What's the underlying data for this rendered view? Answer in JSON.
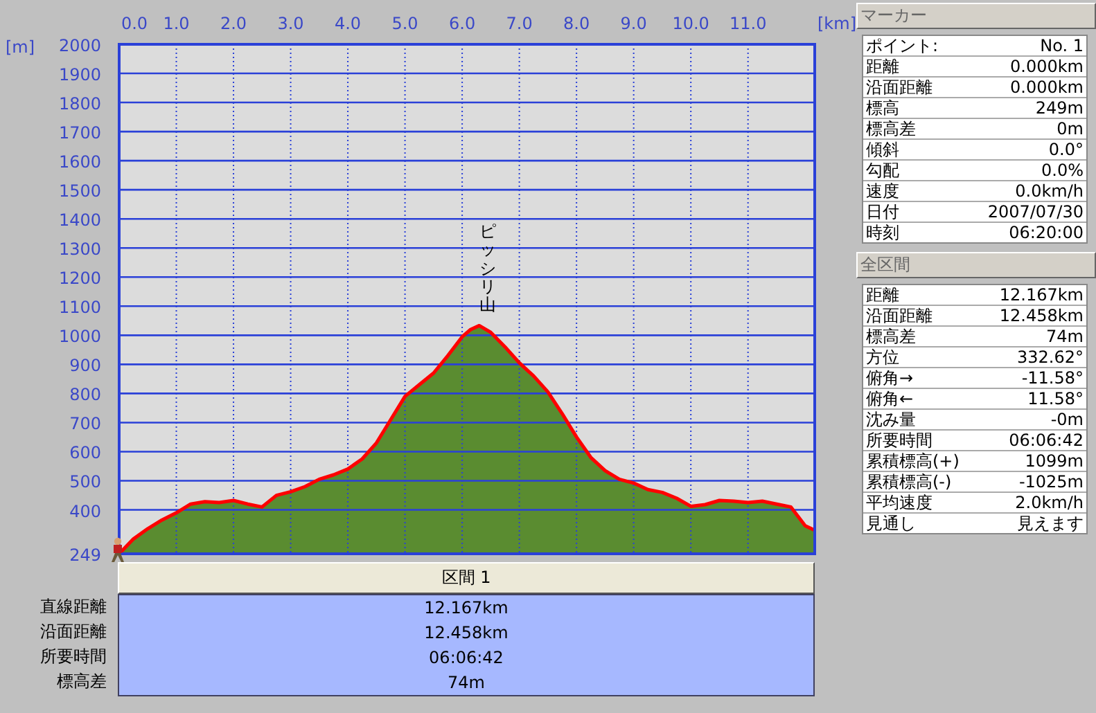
{
  "chart": {
    "chart_data": {
      "type": "area",
      "xlabel": "[km]",
      "ylabel": "[m]",
      "x": [
        0,
        0.25,
        0.5,
        0.75,
        1.0,
        1.25,
        1.5,
        1.75,
        2.0,
        2.25,
        2.5,
        2.75,
        3.0,
        3.25,
        3.5,
        3.75,
        4.0,
        4.25,
        4.5,
        4.75,
        5.0,
        5.25,
        5.5,
        5.75,
        6.0,
        6.15,
        6.3,
        6.5,
        6.75,
        7.0,
        7.25,
        7.5,
        7.75,
        8.0,
        8.25,
        8.5,
        8.75,
        9.0,
        9.25,
        9.5,
        9.75,
        10.0,
        10.25,
        10.5,
        10.75,
        11.0,
        11.25,
        11.5,
        11.75,
        12.0,
        12.167
      ],
      "grid": true,
      "series": [
        {
          "color": "#5a8c30",
          "values": [
            249,
            300,
            335,
            365,
            390,
            420,
            428,
            425,
            432,
            420,
            410,
            450,
            462,
            480,
            505,
            520,
            540,
            575,
            630,
            710,
            790,
            830,
            870,
            930,
            995,
            1020,
            1033,
            1010,
            960,
            905,
            860,
            805,
            730,
            650,
            580,
            535,
            505,
            492,
            470,
            460,
            440,
            412,
            418,
            432,
            430,
            425,
            430,
            420,
            410,
            345,
            330
          ]
        }
      ],
      "xlim": [
        0,
        12.167
      ],
      "ylim": [
        249,
        2000
      ],
      "xticks": [
        {
          "value": 0,
          "label": "0.0"
        },
        {
          "value": 1,
          "label": "1.0"
        },
        {
          "value": 2,
          "label": "2.0"
        },
        {
          "value": 3,
          "label": "3.0"
        },
        {
          "value": 4,
          "label": "4.0"
        },
        {
          "value": 5,
          "label": "5.0"
        },
        {
          "value": 6,
          "label": "6.0"
        },
        {
          "value": 7,
          "label": "7.0"
        },
        {
          "value": 8,
          "label": "8.0"
        },
        {
          "value": 9,
          "label": "9.0"
        },
        {
          "value": 10,
          "label": "10.0"
        },
        {
          "value": 11,
          "label": "11.0"
        }
      ],
      "yticks": [
        249,
        400,
        500,
        600,
        700,
        800,
        900,
        1000,
        1100,
        1200,
        1300,
        1400,
        1500,
        1600,
        1700,
        1800,
        1900,
        2000
      ],
      "annotations": [
        {
          "x": 6.3,
          "y": 1033,
          "text": "ピッシリ山"
        }
      ]
    }
  },
  "section": {
    "label": "区間 1",
    "rows": [
      {
        "label": "直線距離",
        "value": "12.167km"
      },
      {
        "label": "沿面距離",
        "value": "12.458km"
      },
      {
        "label": "所要時間",
        "value": "06:06:42"
      },
      {
        "label": "標高差",
        "value": "74m"
      }
    ]
  },
  "marker_panel": {
    "title": "マーカー",
    "rows": [
      {
        "label": "ポイント:",
        "value": "No. 1"
      },
      {
        "label": "距離",
        "value": "0.000km"
      },
      {
        "label": "沿面距離",
        "value": "0.000km"
      },
      {
        "label": "標高",
        "value": "249m"
      },
      {
        "label": "標高差",
        "value": "0m"
      },
      {
        "label": "傾斜",
        "value": "0.0°"
      },
      {
        "label": "勾配",
        "value": "0.0%"
      },
      {
        "label": "速度",
        "value": "0.0km/h"
      },
      {
        "label": "日付",
        "value": "2007/07/30"
      },
      {
        "label": "時刻",
        "value": "06:20:00"
      }
    ]
  },
  "total_panel": {
    "title": "全区間",
    "rows": [
      {
        "label": "距離",
        "value": "12.167km"
      },
      {
        "label": "沿面距離",
        "value": "12.458km"
      },
      {
        "label": "標高差",
        "value": "74m"
      },
      {
        "label": "方位",
        "value": "332.62°"
      },
      {
        "label": "俯角→",
        "value": "-11.58°"
      },
      {
        "label": "俯角←",
        "value": "11.58°"
      },
      {
        "label": "沈み量",
        "value": "-0m"
      },
      {
        "label": "所要時間",
        "value": "06:06:42"
      },
      {
        "label": "累積標高(+)",
        "value": "1099m"
      },
      {
        "label": "累積標高(-)",
        "value": "-1025m"
      },
      {
        "label": "平均速度",
        "value": "2.0km/h"
      },
      {
        "label": "見通し",
        "value": "見えます"
      }
    ]
  }
}
